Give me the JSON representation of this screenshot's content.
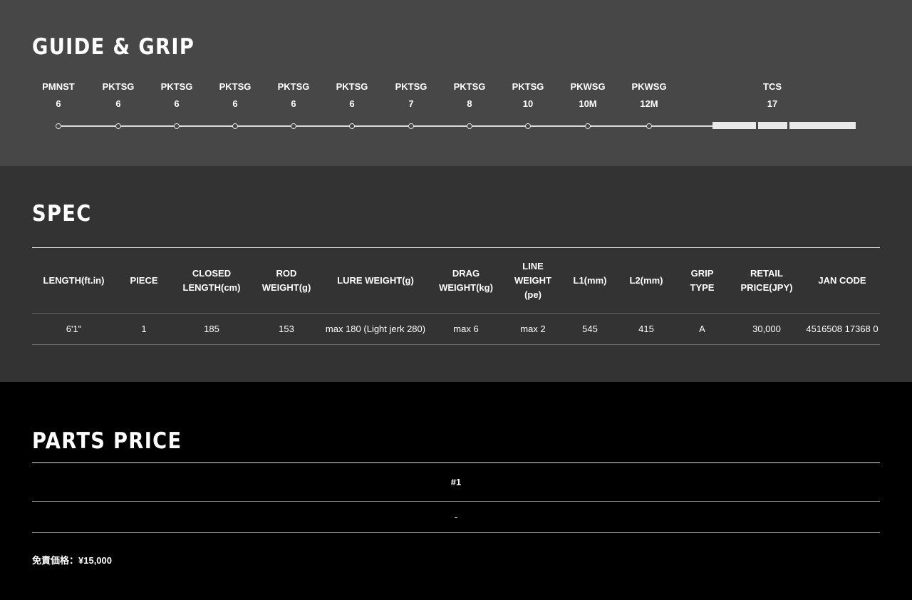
{
  "guide_grip": {
    "title": "GUIDE & GRIP",
    "guides": [
      {
        "model": "PMNST",
        "size": "6"
      },
      {
        "model": "PKTSG",
        "size": "6"
      },
      {
        "model": "PKTSG",
        "size": "6"
      },
      {
        "model": "PKTSG",
        "size": "6"
      },
      {
        "model": "PKTSG",
        "size": "6"
      },
      {
        "model": "PKTSG",
        "size": "6"
      },
      {
        "model": "PKTSG",
        "size": "7"
      },
      {
        "model": "PKTSG",
        "size": "8"
      },
      {
        "model": "PKTSG",
        "size": "10"
      },
      {
        "model": "PKWSG",
        "size": "10M"
      },
      {
        "model": "PKWSG",
        "size": "12M"
      }
    ],
    "reel_seat": {
      "model": "TCS",
      "size": "17"
    }
  },
  "spec": {
    "title": "SPEC",
    "headers": [
      [
        "LENGTH(ft.in)"
      ],
      [
        "PIECE"
      ],
      [
        "CLOSED",
        "LENGTH(cm)"
      ],
      [
        "ROD",
        "WEIGHT(g)"
      ],
      [
        "LURE WEIGHT(g)"
      ],
      [
        "DRAG",
        "WEIGHT(kg)"
      ],
      [
        "LINE",
        "WEIGHT",
        "(pe)"
      ],
      [
        "L1(mm)"
      ],
      [
        "L2(mm)"
      ],
      [
        "GRIP",
        "TYPE"
      ],
      [
        "RETAIL",
        "PRICE(JPY)"
      ],
      [
        "JAN CODE"
      ]
    ],
    "row": [
      "6'1\"",
      "1",
      "185",
      "153",
      "max 180 (Light jerk 280)",
      "max 6",
      "max 2",
      "545",
      "415",
      "A",
      "30,000",
      "4516508 17368 0"
    ]
  },
  "parts_price": {
    "title": "PARTS PRICE",
    "column": "#1",
    "value": "-",
    "note": "免責価格：¥15,000"
  }
}
